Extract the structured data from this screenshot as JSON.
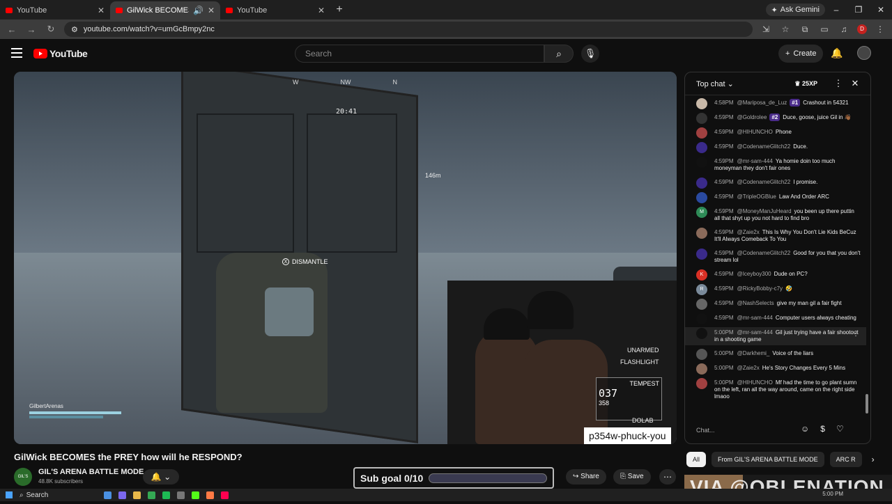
{
  "browser": {
    "tabs": [
      {
        "title": "YouTube",
        "active": false
      },
      {
        "title": "GilWick BECOMES the PREY",
        "active": true
      },
      {
        "title": "YouTube",
        "active": false
      }
    ],
    "ask_gemini": "Ask Gemini",
    "url": "youtube.com/watch?v=umGcBmpy2nc",
    "profile_letter": "D"
  },
  "yt": {
    "logo_text": "YouTube",
    "search_placeholder": "Search",
    "create_label": "Create"
  },
  "game_hud": {
    "compass": [
      "W",
      "NW",
      "N"
    ],
    "timer": "20:41",
    "distance": "146m",
    "prompt_key": "X",
    "prompt": "DISMANTLE",
    "unarmed": "UNARMED",
    "flashlight": "FLASHLIGHT",
    "weapon_name": "TEMPEST",
    "ammo": "037",
    "ammo_reserve": "358",
    "player_name": "GilbertArenas",
    "dolab": "DOLAB"
  },
  "overlay_username": "p354w-phuck-you",
  "video": {
    "title": "GilWick BECOMES the PREY how will he RESPOND?",
    "channel_name": "GIL'S ARENA BATTLE MODE",
    "channel_avatar_text": "GIL'S ARENA",
    "subscribers": "48.8K subscribers",
    "subgoal": "Sub goal 0/10",
    "subgoal_progress": 0,
    "share_label": "Share",
    "save_label": "Save"
  },
  "chat": {
    "header": "Top chat",
    "xp": "25XP",
    "input_placeholder": "Chat...",
    "messages": [
      {
        "time": "4:58PM",
        "author": "@Mariposa_de_Luz",
        "rank": "#1",
        "text": "Crashout in 54321",
        "color": "#c8b8a8"
      },
      {
        "time": "4:59PM",
        "author": "@Goldrolee",
        "rank": "#2",
        "text": "Duce, goose, juice Gil in 👋🏾",
        "color": "#333"
      },
      {
        "time": "4:59PM",
        "author": "@HIHUNCHO",
        "rank": "",
        "text": "Phone",
        "color": "#a04040"
      },
      {
        "time": "4:59PM",
        "author": "@CodenameGlitch22",
        "rank": "",
        "text": "Duce.",
        "color": "#3a2a8a"
      },
      {
        "time": "4:59PM",
        "author": "@mr-sam-444",
        "rank": "",
        "text": "Ya homie doin too much moneyman they don't fair ones",
        "color": "#111"
      },
      {
        "time": "4:59PM",
        "author": "@CodenameGlitch22",
        "rank": "",
        "text": "I promise.",
        "color": "#3a2a8a"
      },
      {
        "time": "4:59PM",
        "author": "@TripleOGBlue",
        "rank": "",
        "text": "Law And Order ARC",
        "color": "#2a4aa0"
      },
      {
        "time": "4:59PM",
        "author": "@MoneyManJuHeard",
        "rank": "",
        "text": "you been up there puttin all that shyt up you not hard to find bro",
        "color": "#2e8b57",
        "letter": "M"
      },
      {
        "time": "4:59PM",
        "author": "@Zaie2x",
        "rank": "",
        "text": "This Is Why You Don't Lie Kids BeCuz It'll Always Comeback To You",
        "color": "#8a6a5a"
      },
      {
        "time": "4:59PM",
        "author": "@CodenameGlitch22",
        "rank": "",
        "text": "Good for you that you don't stream lol",
        "color": "#3a2a8a"
      },
      {
        "time": "4:59PM",
        "author": "@Iceyboy300",
        "rank": "",
        "text": "Dude on PC?",
        "color": "#d93025",
        "letter": "K"
      },
      {
        "time": "4:59PM",
        "author": "@RickyBobby-c7y",
        "rank": "",
        "text": "🤣",
        "color": "#7a8a9a",
        "letter": "R"
      },
      {
        "time": "4:59PM",
        "author": "@NashSelects",
        "rank": "",
        "text": "give my man gil a fair fight",
        "color": "#666"
      },
      {
        "time": "4:59PM",
        "author": "@mr-sam-444",
        "rank": "",
        "text": "Computer users always cheating",
        "color": "#111"
      },
      {
        "time": "5:00PM",
        "author": "@mr-sam-444",
        "rank": "",
        "text": "Gil just trying have a fair shootout in a shooting game",
        "color": "#111",
        "highlight": true
      },
      {
        "time": "5:00PM",
        "author": "@Darkhemi_",
        "rank": "",
        "text": "Voice of the liars",
        "color": "#555"
      },
      {
        "time": "5:00PM",
        "author": "@Zaie2x",
        "rank": "",
        "text": "He's Story Changes Every 5 Mins",
        "color": "#8a6a5a"
      },
      {
        "time": "5:00PM",
        "author": "@HIHUNCHO",
        "rank": "",
        "text": "Mf had the time to go plant sumn on the left, ran all the way around, came on the right side lmaoo",
        "color": "#a04040"
      }
    ]
  },
  "filters": [
    "All",
    "From GIL'S ARENA BATTLE MODE",
    "ARC R"
  ],
  "watermark": "VIA @OBLENATION",
  "taskbar": {
    "search": "Search",
    "time": "5:00 PM"
  },
  "colors": {
    "accent": "#ff0000",
    "rank_badge": "#4a2b8a"
  }
}
